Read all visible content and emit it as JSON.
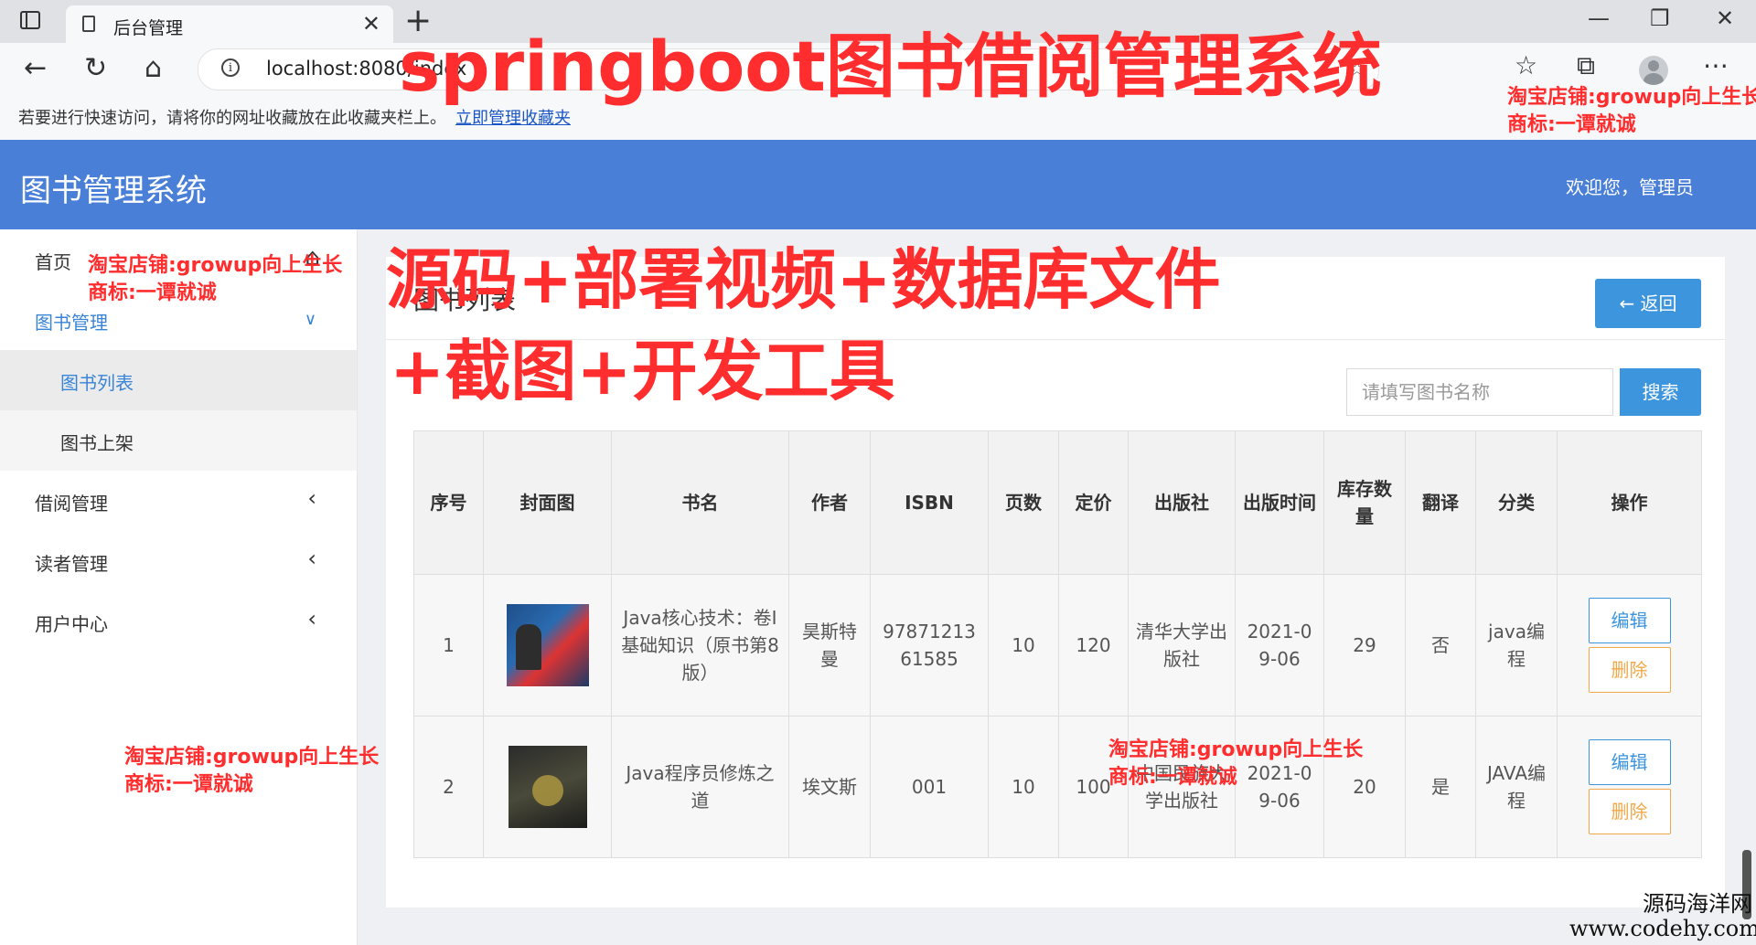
{
  "browser": {
    "tab_title": "后台管理",
    "url": "localhost:8080/index",
    "favorites_hint": "若要进行快速访问，请将你的网址收藏放在此收藏夹栏上。",
    "favorites_link": "立即管理收藏夹"
  },
  "header": {
    "app_title": "图书管理系统",
    "welcome": "欢迎您，管理员"
  },
  "sidebar": {
    "items": [
      {
        "label": "首页"
      },
      {
        "label": "图书管理"
      },
      {
        "label": "图书列表"
      },
      {
        "label": "图书上架"
      },
      {
        "label": "借阅管理"
      },
      {
        "label": "读者管理"
      },
      {
        "label": "用户中心"
      }
    ]
  },
  "main": {
    "title": "图书列表",
    "back_label": "← 返回",
    "search_placeholder": "请填写图书名称",
    "search_label": "搜索",
    "columns": [
      "序号",
      "封面图",
      "书名",
      "作者",
      "ISBN",
      "页数",
      "定价",
      "出版社",
      "出版时间",
      "库存数量",
      "翻译",
      "分类",
      "操作"
    ],
    "rows": [
      {
        "index": "1",
        "title": "Java核心技术：卷Ⅰ基础知识（原书第8版）",
        "author": "昊斯特曼",
        "isbn": "9787121361585",
        "pages": "10",
        "price": "120",
        "publisher": "清华大学出版社",
        "publish_date": "2021-09-06",
        "stock": "29",
        "translated": "否",
        "category": "java编程",
        "edit_label": "编辑",
        "delete_label": "删除"
      },
      {
        "index": "2",
        "title": "Java程序员修炼之道",
        "author": "埃文斯",
        "isbn": "001",
        "pages": "10",
        "price": "100",
        "publisher": "中国民族大学出版社",
        "publish_date": "2021-09-06",
        "stock": "20",
        "translated": "是",
        "category": "JAVA编程",
        "edit_label": "编辑",
        "delete_label": "删除"
      }
    ]
  },
  "overlays": {
    "headline": "springboot图书借阅管理系统",
    "promo_line1": "源码+部署视频+数据库文件",
    "promo_line2": "+截图+开发工具",
    "shop": "淘宝店铺:growup向上生长",
    "brand": "商标:一谭就诚",
    "site_name": "源码海洋网",
    "site_url": "www.codehy.com"
  },
  "colors": {
    "header_bg": "#4a7fd8",
    "accent": "#3d95de",
    "delete": "#f0a84a",
    "overlay_red": "#ff2d2d"
  }
}
